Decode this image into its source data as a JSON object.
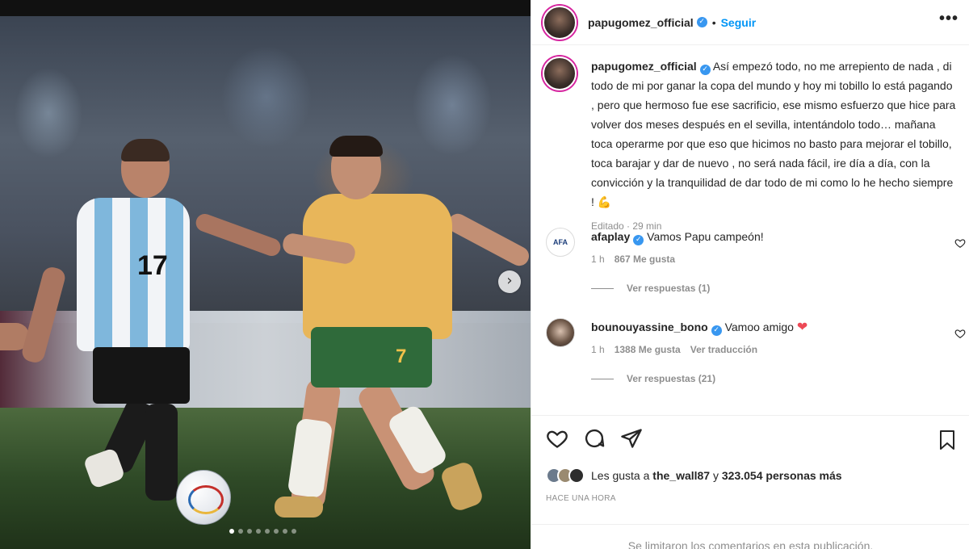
{
  "post": {
    "username": "papugomez_official",
    "follow_label": "Seguir",
    "more_label": "•••",
    "caption": "Así empezó todo, no me arrepiento de nada , di todo de mi por ganar la copa del mundo y hoy mi tobillo lo está pagando , pero que hermoso fue ese sacrificio, ese mismo esfuerzo que hice para volver dos meses después en el sevilla, intentándolo todo… mañana toca operarme por que eso que hicimos no basto para mejorar el tobillo, toca barajar y dar de nuevo , no será nada fácil, ire día a día, con la convicción y la tranquilidad de dar todo de mi como lo he hecho siempre !",
    "caption_emoji": "💪",
    "edited_label": "Editado · 29 min"
  },
  "photo": {
    "jersey_number_1": "17",
    "jersey_number_2": "7",
    "next_arrow": "›",
    "carousel_count": 8,
    "carousel_active": 0
  },
  "comments": [
    {
      "username": "afaplay",
      "avatar_text": "AFA",
      "text": "Vamos Papu campeón!",
      "time": "1 h",
      "likes": "867 Me gusta",
      "translate": "",
      "replies": "Ver respuestas (1)"
    },
    {
      "username": "bounouyassine_bono",
      "text": "Vamoo amigo",
      "emoji": "❤",
      "time": "1 h",
      "likes": "1388 Me gusta",
      "translate": "Ver traducción",
      "replies": "Ver respuestas (21)"
    }
  ],
  "likes": {
    "prefix": "Les gusta a",
    "user": "the_wall87",
    "joiner": "y",
    "count": "323.054 personas más"
  },
  "time_ago": "HACE UNA HORA",
  "limited_notice": "Se limitaron los comentarios en esta publicación."
}
